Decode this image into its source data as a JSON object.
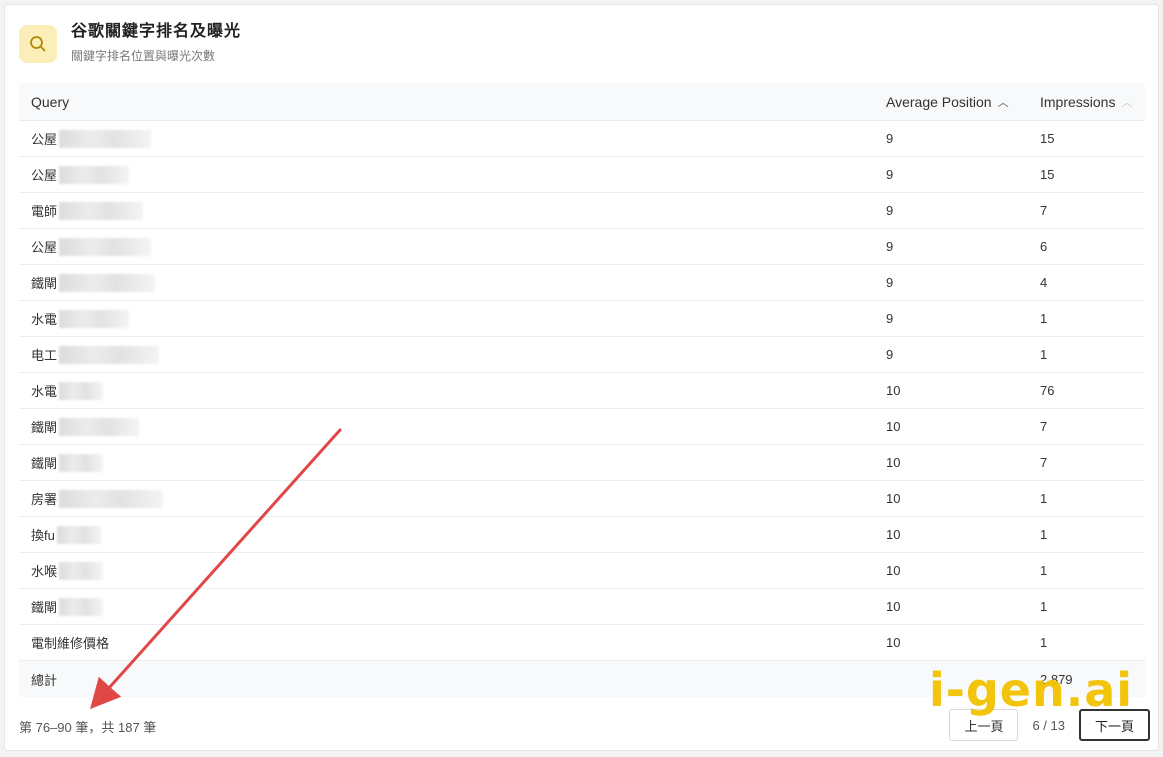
{
  "header": {
    "title": "谷歌關鍵字排名及曝光",
    "subtitle": "關鍵字排名位置與曝光次數",
    "icon": "search-icon",
    "icon_bg": "#fbeeb8"
  },
  "table": {
    "columns": {
      "query": "Query",
      "position": "Average Position",
      "impressions": "Impressions"
    },
    "rows": [
      {
        "query": "公屋",
        "position": "9",
        "impressions": "15"
      },
      {
        "query": "公屋",
        "position": "9",
        "impressions": "15"
      },
      {
        "query": "電師",
        "position": "9",
        "impressions": "7"
      },
      {
        "query": "公屋",
        "position": "9",
        "impressions": "6"
      },
      {
        "query": "鐵閘",
        "position": "9",
        "impressions": "4"
      },
      {
        "query": "水電",
        "position": "9",
        "impressions": "1"
      },
      {
        "query": "电工",
        "position": "9",
        "impressions": "1"
      },
      {
        "query": "水電",
        "position": "10",
        "impressions": "76"
      },
      {
        "query": "鐵閘",
        "position": "10",
        "impressions": "7"
      },
      {
        "query": "鐵閘",
        "position": "10",
        "impressions": "7"
      },
      {
        "query": "房署",
        "position": "10",
        "impressions": "1"
      },
      {
        "query": "換fu",
        "position": "10",
        "impressions": "1"
      },
      {
        "query": "水喉",
        "position": "10",
        "impressions": "1"
      },
      {
        "query": "鐵閘",
        "position": "10",
        "impressions": "1"
      },
      {
        "query": "電制維修價格",
        "position": "10",
        "impressions": "1"
      }
    ],
    "total_label": "總計",
    "total_impressions": "2,879"
  },
  "footer": {
    "range_text": "第 76–90 筆，共 187 筆",
    "prev_label": "上一頁",
    "page_info": "6 / 13",
    "next_label": "下一頁"
  },
  "watermark": "i-gen.ai",
  "colors": {
    "accent": "#f2c200",
    "annotation_arrow": "#e04848"
  }
}
